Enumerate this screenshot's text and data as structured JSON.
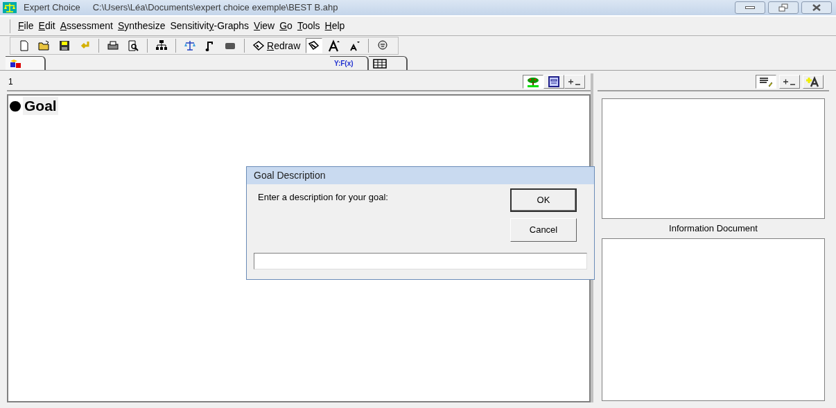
{
  "window": {
    "app_name": "Expert Choice",
    "file_path": "C:\\Users\\Léa\\Documents\\expert choice exemple\\BEST B.ahp"
  },
  "menu": [
    {
      "key": "F",
      "after": "ile"
    },
    {
      "key": "E",
      "after": "dit"
    },
    {
      "key": "A",
      "after": "ssessment"
    },
    {
      "key": "S",
      "after": "ynthesize"
    },
    {
      "before": "Sensitivit",
      "key": "y",
      "after": "-Graphs"
    },
    {
      "key": "V",
      "after": "iew"
    },
    {
      "key": "G",
      "after": "o"
    },
    {
      "key": "T",
      "after": "ools"
    },
    {
      "key": "H",
      "after": "elp"
    }
  ],
  "toolbar": [
    {
      "kind": "new"
    },
    {
      "kind": "open"
    },
    {
      "kind": "save"
    },
    {
      "kind": "undo"
    },
    {
      "kind": "sep"
    },
    {
      "kind": "print"
    },
    {
      "kind": "preview"
    },
    {
      "kind": "sep"
    },
    {
      "kind": "hierarchy"
    },
    {
      "kind": "sep"
    },
    {
      "kind": "scale"
    },
    {
      "kind": "note"
    },
    {
      "kind": "bar"
    },
    {
      "kind": "sep"
    },
    {
      "kind": "redraw",
      "label": {
        "key": "R",
        "after": "edraw"
      }
    },
    {
      "kind": "edit",
      "pressed": true
    },
    {
      "kind": "font-up"
    },
    {
      "kind": "font-down"
    },
    {
      "kind": "sep"
    },
    {
      "kind": "help"
    }
  ],
  "tabs": [
    {
      "kind": "blocks",
      "selected": true
    },
    {
      "kind": "formula",
      "label": "Y:F(x)",
      "selected": false
    },
    {
      "kind": "grid",
      "selected": false
    }
  ],
  "left_pane": {
    "number": "1",
    "buttons": [
      {
        "kind": "tree",
        "pressed": true
      },
      {
        "kind": "frame",
        "pressed": false
      },
      {
        "kind": "plusminus",
        "pressed": false
      }
    ],
    "goal": "Goal"
  },
  "right_pane": {
    "buttons": [
      {
        "kind": "lines",
        "pressed": true
      },
      {
        "kind": "plusminus",
        "pressed": false
      },
      {
        "kind": "find",
        "pressed": false
      }
    ],
    "info_label": "Information Document"
  },
  "dialog": {
    "title": "Goal Description",
    "prompt": "Enter a description for your goal:",
    "buttons": [
      "OK",
      "Cancel"
    ]
  }
}
